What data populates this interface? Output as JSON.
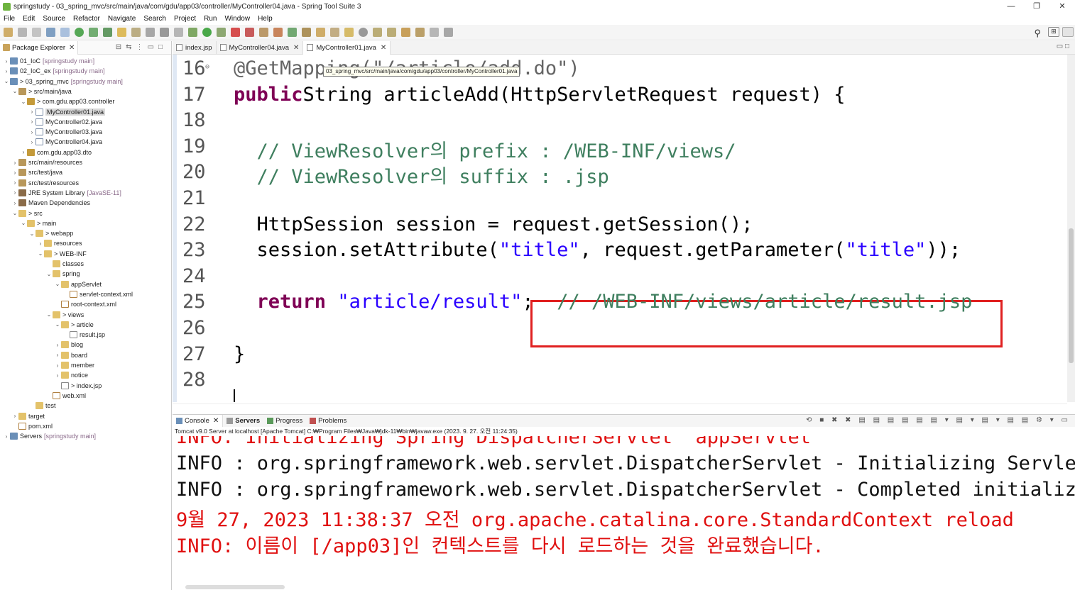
{
  "window": {
    "title": "springstudy - 03_spring_mvc/src/main/java/com/gdu/app03/controller/MyController04.java - Spring Tool Suite 3",
    "minimize": "—",
    "restore": "❐",
    "close": "✕"
  },
  "menu": [
    "File",
    "Edit",
    "Source",
    "Refactor",
    "Navigate",
    "Search",
    "Project",
    "Run",
    "Window",
    "Help"
  ],
  "package_explorer": {
    "tab_label": "Package Explorer",
    "tree": [
      {
        "label": "01_IoC",
        "dec": "[springstudy main]",
        "indent": 0,
        "expanded": false,
        "icon": "project-icon"
      },
      {
        "label": "02_IoC_ex",
        "dec": "[springstudy main]",
        "indent": 0,
        "expanded": false,
        "icon": "project-icon"
      },
      {
        "label": "> 03_spring_mvc",
        "dec": "[springstudy main]",
        "indent": 0,
        "expanded": true,
        "icon": "project-icon"
      },
      {
        "label": "> src/main/java",
        "dec": "",
        "indent": 1,
        "expanded": true,
        "icon": "source-folder-icon"
      },
      {
        "label": "> com.gdu.app03.controller",
        "dec": "",
        "indent": 2,
        "expanded": true,
        "icon": "package-icon"
      },
      {
        "label": "MyController01.java",
        "dec": "",
        "indent": 3,
        "expanded": false,
        "icon": "java-file-icon",
        "selected": true
      },
      {
        "label": "MyController02.java",
        "dec": "",
        "indent": 3,
        "expanded": false,
        "icon": "java-file-icon"
      },
      {
        "label": "MyController03.java",
        "dec": "",
        "indent": 3,
        "expanded": false,
        "icon": "java-file-icon"
      },
      {
        "label": "MyController04.java",
        "dec": "",
        "indent": 3,
        "expanded": false,
        "icon": "java-file-icon"
      },
      {
        "label": "com.gdu.app03.dto",
        "dec": "",
        "indent": 2,
        "expanded": false,
        "icon": "package-icon"
      },
      {
        "label": "src/main/resources",
        "dec": "",
        "indent": 1,
        "expanded": false,
        "icon": "source-folder-icon"
      },
      {
        "label": "src/test/java",
        "dec": "",
        "indent": 1,
        "expanded": false,
        "icon": "source-folder-icon"
      },
      {
        "label": "src/test/resources",
        "dec": "",
        "indent": 1,
        "expanded": false,
        "icon": "source-folder-icon"
      },
      {
        "label": "JRE System Library",
        "dec": "[JavaSE-11]",
        "indent": 1,
        "expanded": false,
        "icon": "library-icon"
      },
      {
        "label": "Maven Dependencies",
        "dec": "",
        "indent": 1,
        "expanded": false,
        "icon": "library-icon"
      },
      {
        "label": "> src",
        "dec": "",
        "indent": 1,
        "expanded": true,
        "icon": "folder-icon"
      },
      {
        "label": "> main",
        "dec": "",
        "indent": 2,
        "expanded": true,
        "icon": "folder-icon"
      },
      {
        "label": "> webapp",
        "dec": "",
        "indent": 3,
        "expanded": true,
        "icon": "folder-icon"
      },
      {
        "label": "resources",
        "dec": "",
        "indent": 4,
        "expanded": false,
        "icon": "folder-icon"
      },
      {
        "label": "> WEB-INF",
        "dec": "",
        "indent": 4,
        "expanded": true,
        "icon": "folder-icon"
      },
      {
        "label": "classes",
        "dec": "",
        "indent": 5,
        "leaf": true,
        "icon": "folder-icon"
      },
      {
        "label": "spring",
        "dec": "",
        "indent": 5,
        "expanded": true,
        "icon": "folder-icon"
      },
      {
        "label": "appServlet",
        "dec": "",
        "indent": 6,
        "expanded": true,
        "icon": "folder-icon"
      },
      {
        "label": "servlet-context.xml",
        "dec": "",
        "indent": 7,
        "leaf": true,
        "icon": "xml-file-icon"
      },
      {
        "label": "root-context.xml",
        "dec": "",
        "indent": 6,
        "leaf": true,
        "icon": "xml-file-icon"
      },
      {
        "label": "> views",
        "dec": "",
        "indent": 5,
        "expanded": true,
        "icon": "folder-icon"
      },
      {
        "label": "> article",
        "dec": "",
        "indent": 6,
        "expanded": true,
        "icon": "folder-icon"
      },
      {
        "label": "result.jsp",
        "dec": "",
        "indent": 7,
        "leaf": true,
        "icon": "jsp-file-icon"
      },
      {
        "label": "blog",
        "dec": "",
        "indent": 6,
        "expanded": false,
        "icon": "folder-icon"
      },
      {
        "label": "board",
        "dec": "",
        "indent": 6,
        "expanded": false,
        "icon": "folder-icon"
      },
      {
        "label": "member",
        "dec": "",
        "indent": 6,
        "expanded": false,
        "icon": "folder-icon"
      },
      {
        "label": "notice",
        "dec": "",
        "indent": 6,
        "expanded": false,
        "icon": "folder-icon"
      },
      {
        "label": "> index.jsp",
        "dec": "",
        "indent": 6,
        "leaf": true,
        "icon": "jsp-file-icon"
      },
      {
        "label": "web.xml",
        "dec": "",
        "indent": 5,
        "leaf": true,
        "icon": "xml-file-icon"
      },
      {
        "label": "test",
        "dec": "",
        "indent": 3,
        "leaf": true,
        "icon": "folder-icon"
      },
      {
        "label": "target",
        "dec": "",
        "indent": 1,
        "expanded": false,
        "icon": "folder-icon"
      },
      {
        "label": "pom.xml",
        "dec": "",
        "indent": 1,
        "leaf": true,
        "icon": "xml-file-icon"
      },
      {
        "label": "Servers",
        "dec": "[springstudy main]",
        "indent": 0,
        "expanded": false,
        "icon": "project-icon"
      }
    ]
  },
  "editor": {
    "tabs": [
      {
        "label": "index.jsp",
        "active": false,
        "closable": false
      },
      {
        "label": "MyController04.java",
        "active": false,
        "closable": true
      },
      {
        "label": "MyController01.java",
        "active": true,
        "closable": true
      }
    ],
    "tooltip": "03_spring_mvc/src/main/java/com/gdu/app03/controller/MyController01.java",
    "lines": [
      {
        "n": "16",
        "fold": "⊖",
        "segs": [
          [
            "an",
            "@GetMapping(\"/article/add.do\")"
          ]
        ]
      },
      {
        "n": "17",
        "segs": [
          [
            "kw",
            "public"
          ],
          [
            "",
            "String articleAdd(HttpServletRequest request) {"
          ]
        ]
      },
      {
        "n": "18",
        "segs": []
      },
      {
        "n": "19",
        "segs": [
          [
            "cm",
            "  // ViewResolver의 prefix : /WEB-INF/views/"
          ]
        ]
      },
      {
        "n": "20",
        "segs": [
          [
            "cm",
            "  // ViewResolver의 suffix : .jsp"
          ]
        ]
      },
      {
        "n": "21",
        "segs": []
      },
      {
        "n": "22",
        "segs": [
          [
            "",
            "  HttpSession session = request.getSession();"
          ]
        ]
      },
      {
        "n": "23",
        "segs": [
          [
            "",
            "  session.setAttribute("
          ],
          [
            "st",
            "\"title\""
          ],
          [
            "",
            ", request.getParameter("
          ],
          [
            "st",
            "\"title\""
          ],
          [
            "",
            "));"
          ]
        ]
      },
      {
        "n": "24",
        "segs": []
      },
      {
        "n": "25",
        "segs": [
          [
            "kw",
            "  return "
          ],
          [
            "st",
            "\"article/result\""
          ],
          [
            "",
            ";  "
          ],
          [
            "cm",
            "// /WEB-INF/views/article/result.jsp"
          ]
        ]
      },
      {
        "n": "26",
        "segs": []
      },
      {
        "n": "27",
        "segs": [
          [
            "",
            "}"
          ]
        ]
      },
      {
        "n": "28",
        "segs": []
      }
    ]
  },
  "console": {
    "tabs": [
      "Console",
      "Servers",
      "Progress",
      "Problems"
    ],
    "subtitle": "Tomcat v9.0 Server at localhost [Apache Tomcat] C:₩Program Files₩Java₩jdk-11₩bin₩javaw.exe  (2023. 9. 27. 오전 11:24:35)",
    "lines": [
      {
        "color": "red",
        "text": "INFO: Initializing Spring DispatcherServlet 'appServlet'"
      },
      {
        "color": "black",
        "text": "INFO : org.springframework.web.servlet.DispatcherServlet - Initializing Servlet"
      },
      {
        "color": "black",
        "text": "INFO : org.springframework.web.servlet.DispatcherServlet - Completed initializat"
      },
      {
        "color": "red",
        "text": "9월 27, 2023 11:38:37 오전 org.apache.catalina.core.StandardContext reload"
      },
      {
        "color": "red",
        "text": "INFO: 이름이 [/app03]인 컨텍스트를 다시 로드하는 것을 완료했습니다."
      }
    ]
  },
  "colors": {
    "keyword": "#7f0055",
    "comment": "#3f7f5f",
    "string": "#2a00ff",
    "annotation": "#646464",
    "highlight_box": "#e02020",
    "console_error": "#e01010"
  }
}
